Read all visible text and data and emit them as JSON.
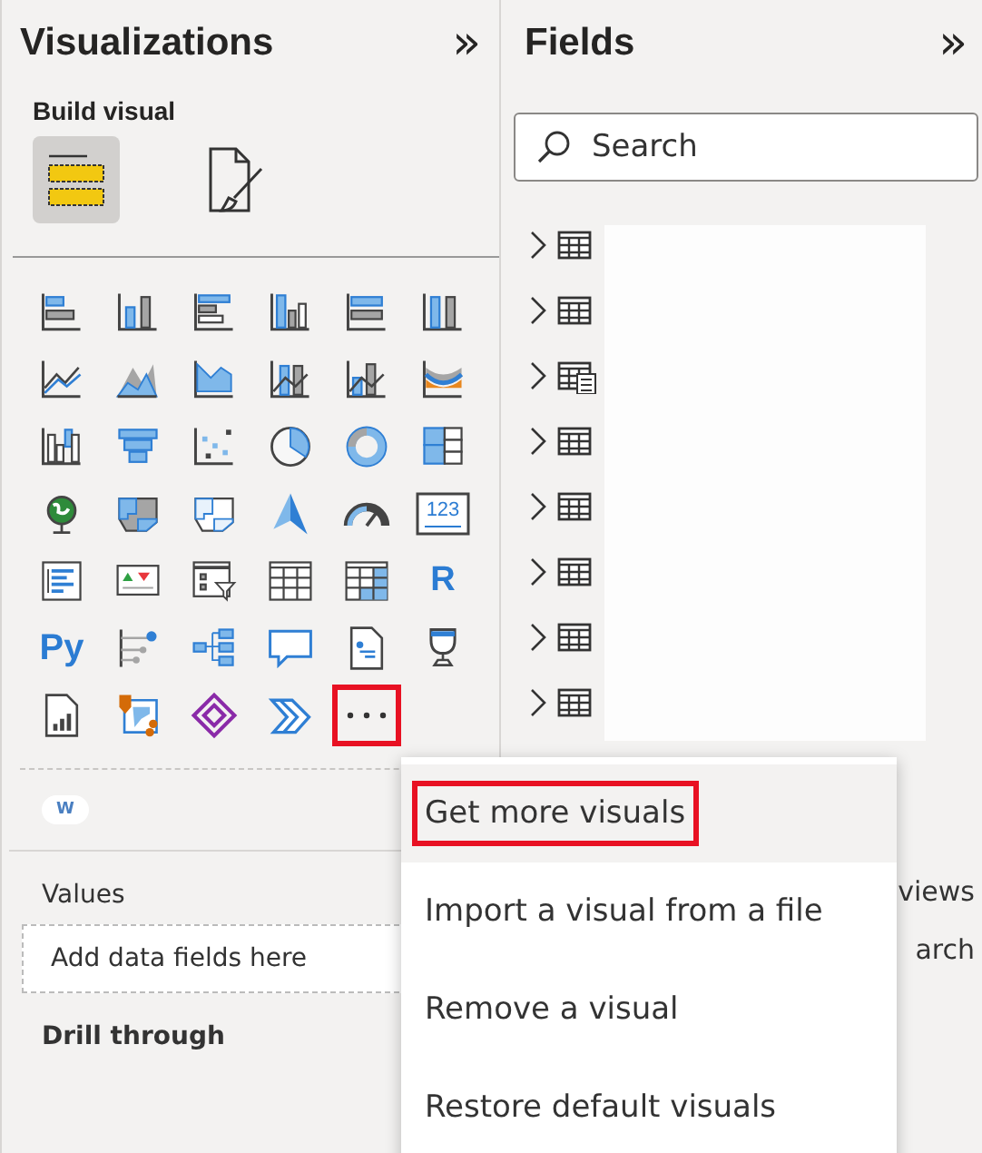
{
  "visualizations": {
    "title": "Visualizations",
    "collapse": "»",
    "section": "Build visual",
    "tabs": [
      {
        "kind": "build",
        "selected": true
      },
      {
        "kind": "format",
        "selected": false
      }
    ],
    "visuals": [
      {
        "kind": "icon"
      },
      {
        "kind": "icon"
      },
      {
        "kind": "icon"
      },
      {
        "kind": "icon"
      },
      {
        "kind": "icon"
      },
      {
        "kind": "icon"
      },
      {
        "kind": "icon"
      },
      {
        "kind": "icon"
      },
      {
        "kind": "icon"
      },
      {
        "kind": "icon"
      },
      {
        "kind": "icon"
      },
      {
        "kind": "icon"
      },
      {
        "kind": "icon"
      },
      {
        "kind": "icon"
      },
      {
        "kind": "icon"
      },
      {
        "kind": "icon"
      },
      {
        "kind": "icon"
      },
      {
        "kind": "icon"
      },
      {
        "kind": "icon"
      },
      {
        "kind": "icon"
      },
      {
        "kind": "icon"
      },
      {
        "kind": "icon"
      },
      {
        "kind": "icon"
      },
      {
        "kind": "card",
        "label": "123"
      },
      {
        "kind": "icon"
      },
      {
        "kind": "icon"
      },
      {
        "kind": "icon"
      },
      {
        "kind": "icon"
      },
      {
        "kind": "icon"
      },
      {
        "kind": "text",
        "label": "R"
      },
      {
        "kind": "text",
        "label": "Py"
      },
      {
        "kind": "icon"
      },
      {
        "kind": "icon"
      },
      {
        "kind": "icon"
      },
      {
        "kind": "icon"
      },
      {
        "kind": "icon"
      },
      {
        "kind": "icon"
      },
      {
        "kind": "icon"
      },
      {
        "kind": "icon"
      },
      {
        "kind": "icon"
      },
      {
        "kind": "more",
        "highlighted": true
      }
    ],
    "custom_visual": {
      "label": "W"
    },
    "values": {
      "label": "Values",
      "placeholder": "Add data fields here"
    },
    "drill_through": "Drill through"
  },
  "fields": {
    "title": "Fields",
    "collapse": "»",
    "search": {
      "placeholder": "Search"
    },
    "tables": [
      {
        "kind": "table"
      },
      {
        "kind": "table"
      },
      {
        "kind": "calculated"
      },
      {
        "kind": "table"
      },
      {
        "kind": "table"
      },
      {
        "kind": "table"
      },
      {
        "kind": "table"
      },
      {
        "kind": "table"
      }
    ],
    "partial_texts": [
      "views",
      "arch"
    ]
  },
  "menu": {
    "items": [
      {
        "label": "Get more visuals",
        "selected": true,
        "highlighted": true
      },
      {
        "label": "Import a visual from a file",
        "selected": false,
        "highlighted": false
      },
      {
        "label": "Remove a visual",
        "selected": false,
        "highlighted": false
      },
      {
        "label": "Restore default visuals",
        "selected": false,
        "highlighted": false
      }
    ]
  }
}
